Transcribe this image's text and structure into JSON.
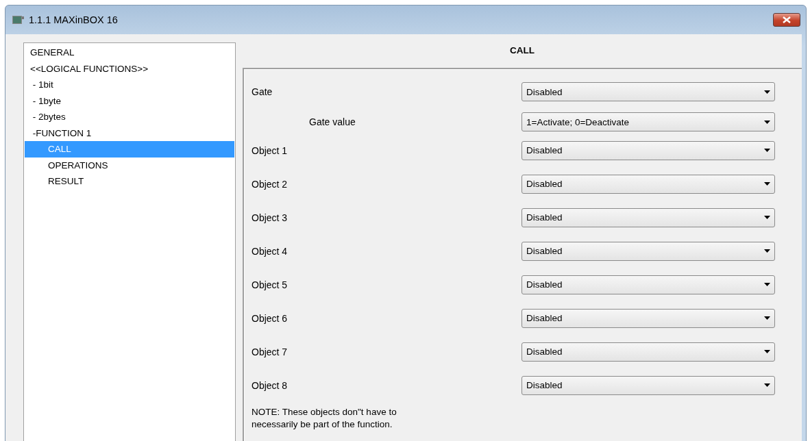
{
  "window": {
    "title": "1.1.1 MAXinBOX 16"
  },
  "sidebar": {
    "items": [
      {
        "label": "GENERAL",
        "selected": false
      },
      {
        "label": "<<LOGICAL FUNCTIONS>>",
        "selected": false
      },
      {
        "label": " - 1bit",
        "selected": false
      },
      {
        "label": " - 1byte",
        "selected": false
      },
      {
        "label": " - 2bytes",
        "selected": false
      },
      {
        "label": " -FUNCTION 1",
        "selected": false,
        "children": [
          {
            "label": "CALL",
            "selected": true
          },
          {
            "label": "OPERATIONS",
            "selected": false
          },
          {
            "label": "RESULT",
            "selected": false
          }
        ]
      }
    ]
  },
  "panel": {
    "title": "CALL",
    "rows": [
      {
        "kind": "main",
        "label": "Gate",
        "value": "Disabled"
      },
      {
        "kind": "sub",
        "label": "Gate value",
        "value": "1=Activate; 0=Deactivate"
      },
      {
        "kind": "main",
        "label": "Object 1",
        "value": "Disabled"
      },
      {
        "kind": "main",
        "label": "Object 2",
        "value": "Disabled"
      },
      {
        "kind": "main",
        "label": "Object 3",
        "value": "Disabled"
      },
      {
        "kind": "main",
        "label": "Object 4",
        "value": "Disabled"
      },
      {
        "kind": "main",
        "label": "Object 5",
        "value": "Disabled"
      },
      {
        "kind": "main",
        "label": "Object 6",
        "value": "Disabled"
      },
      {
        "kind": "main",
        "label": "Object 7",
        "value": "Disabled"
      },
      {
        "kind": "main",
        "label": "Object 8",
        "value": "Disabled"
      }
    ],
    "note": "NOTE: These objects don\"t have to necessarily be part of the function."
  }
}
